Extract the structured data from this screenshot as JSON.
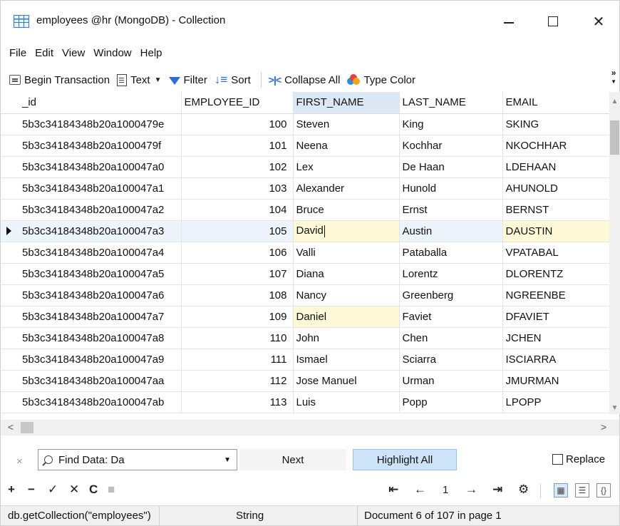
{
  "window": {
    "title": "employees @hr (MongoDB) - Collection",
    "minimize_label": "",
    "close_label": "✕"
  },
  "menu": [
    "File",
    "Edit",
    "View",
    "Window",
    "Help"
  ],
  "toolbar": {
    "begin_transaction": "Begin Transaction",
    "text": "Text",
    "filter": "Filter",
    "sort": "Sort",
    "collapse_all": "Collapse All",
    "type_color": "Type Color",
    "overflow": "»"
  },
  "grid": {
    "columns": [
      "_id",
      "EMPLOYEE_ID",
      "FIRST_NAME",
      "LAST_NAME",
      "EMAIL"
    ],
    "selected_column": "FIRST_NAME",
    "current_row_index": 5,
    "rows": [
      [
        "5b3c34184348b20a1000479e",
        "100",
        "Steven",
        "King",
        "SKING"
      ],
      [
        "5b3c34184348b20a1000479f",
        "101",
        "Neena",
        "Kochhar",
        "NKOCHHAR"
      ],
      [
        "5b3c34184348b20a100047a0",
        "102",
        "Lex",
        "De Haan",
        "LDEHAAN"
      ],
      [
        "5b3c34184348b20a100047a1",
        "103",
        "Alexander",
        "Hunold",
        "AHUNOLD"
      ],
      [
        "5b3c34184348b20a100047a2",
        "104",
        "Bruce",
        "Ernst",
        "BERNST"
      ],
      [
        "5b3c34184348b20a100047a3",
        "105",
        "David",
        "Austin",
        "DAUSTIN"
      ],
      [
        "5b3c34184348b20a100047a4",
        "106",
        "Valli",
        "Pataballa",
        "VPATABAL"
      ],
      [
        "5b3c34184348b20a100047a5",
        "107",
        "Diana",
        "Lorentz",
        "DLORENTZ"
      ],
      [
        "5b3c34184348b20a100047a6",
        "108",
        "Nancy",
        "Greenberg",
        "NGREENBE"
      ],
      [
        "5b3c34184348b20a100047a7",
        "109",
        "Daniel",
        "Faviet",
        "DFAVIET"
      ],
      [
        "5b3c34184348b20a100047a8",
        "110",
        "John",
        "Chen",
        "JCHEN"
      ],
      [
        "5b3c34184348b20a100047a9",
        "111",
        "Ismael",
        "Sciarra",
        "ISCIARRA"
      ],
      [
        "5b3c34184348b20a100047aa",
        "112",
        "Jose Manuel",
        "Urman",
        "JMURMAN"
      ],
      [
        "5b3c34184348b20a100047ab",
        "113",
        "Luis",
        "Popp",
        "LPOPP"
      ]
    ],
    "highlight_color": "#fdf9d6",
    "selected_header_color": "#dbe8f5"
  },
  "find": {
    "close": "×",
    "value": "Find Data: Da",
    "next": "Next",
    "highlight_all": "Highlight All",
    "replace": "Replace"
  },
  "nav": {
    "add": "+",
    "remove": "−",
    "apply": "✓",
    "discard": "✕",
    "refresh": "C",
    "stop": "■",
    "first": "⇤",
    "prev": "←",
    "page": "1",
    "next": "→",
    "last": "⇥",
    "settings": "⚙"
  },
  "status": {
    "query": "db.getCollection(\"employees\")",
    "type": "String",
    "position": "Document 6 of 107 in page 1"
  }
}
